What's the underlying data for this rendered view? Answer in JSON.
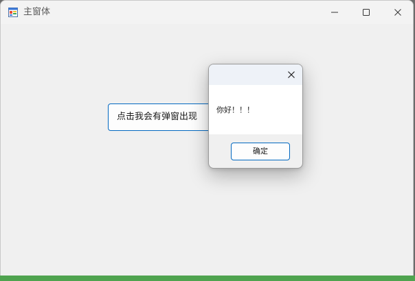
{
  "window": {
    "title": "主窗体",
    "icon": "app-form-icon",
    "controls": [
      "minimize-icon",
      "maximize-icon",
      "close-icon"
    ]
  },
  "main": {
    "button_label": "点击我会有弹窗出现"
  },
  "dialog": {
    "close_icon": "close-icon",
    "message": "你好！！！",
    "ok_label": "确定"
  },
  "colors": {
    "accent": "#0067c0",
    "window_bg": "#f0f0f0",
    "dialog_title_bg": "#eef2f8"
  }
}
